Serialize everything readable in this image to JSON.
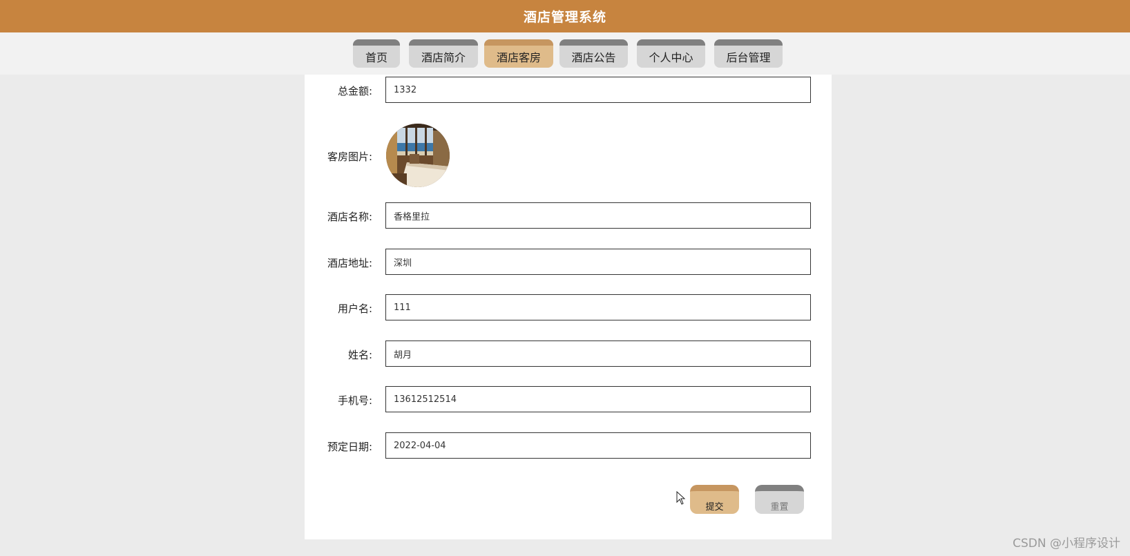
{
  "app": {
    "title": "酒店管理系统"
  },
  "nav": {
    "items": [
      {
        "label": "首页"
      },
      {
        "label": "酒店简介"
      },
      {
        "label": "酒店客房",
        "active": true
      },
      {
        "label": "酒店公告"
      },
      {
        "label": "个人中心"
      },
      {
        "label": "后台管理"
      }
    ]
  },
  "form": {
    "total_amount": {
      "label": "总金额:",
      "value": "1332"
    },
    "room_image": {
      "label": "客房图片:"
    },
    "hotel_name": {
      "label": "酒店名称:",
      "value": "香格里拉"
    },
    "hotel_address": {
      "label": "酒店地址:",
      "value": "深圳"
    },
    "username": {
      "label": "用户名:",
      "value": "111"
    },
    "name": {
      "label": "姓名:",
      "value": "胡月"
    },
    "phone": {
      "label": "手机号:",
      "value": "13612512514"
    },
    "booking_date": {
      "label": "预定日期:",
      "value": "2022-04-04"
    }
  },
  "buttons": {
    "submit": "提交",
    "reset": "重置"
  },
  "watermark": "CSDN @小程序设计",
  "colors": {
    "header": "#c7843f",
    "active_tab": "#dfbb8a",
    "tab": "#d6d6d6",
    "tab_top": "#808080"
  }
}
